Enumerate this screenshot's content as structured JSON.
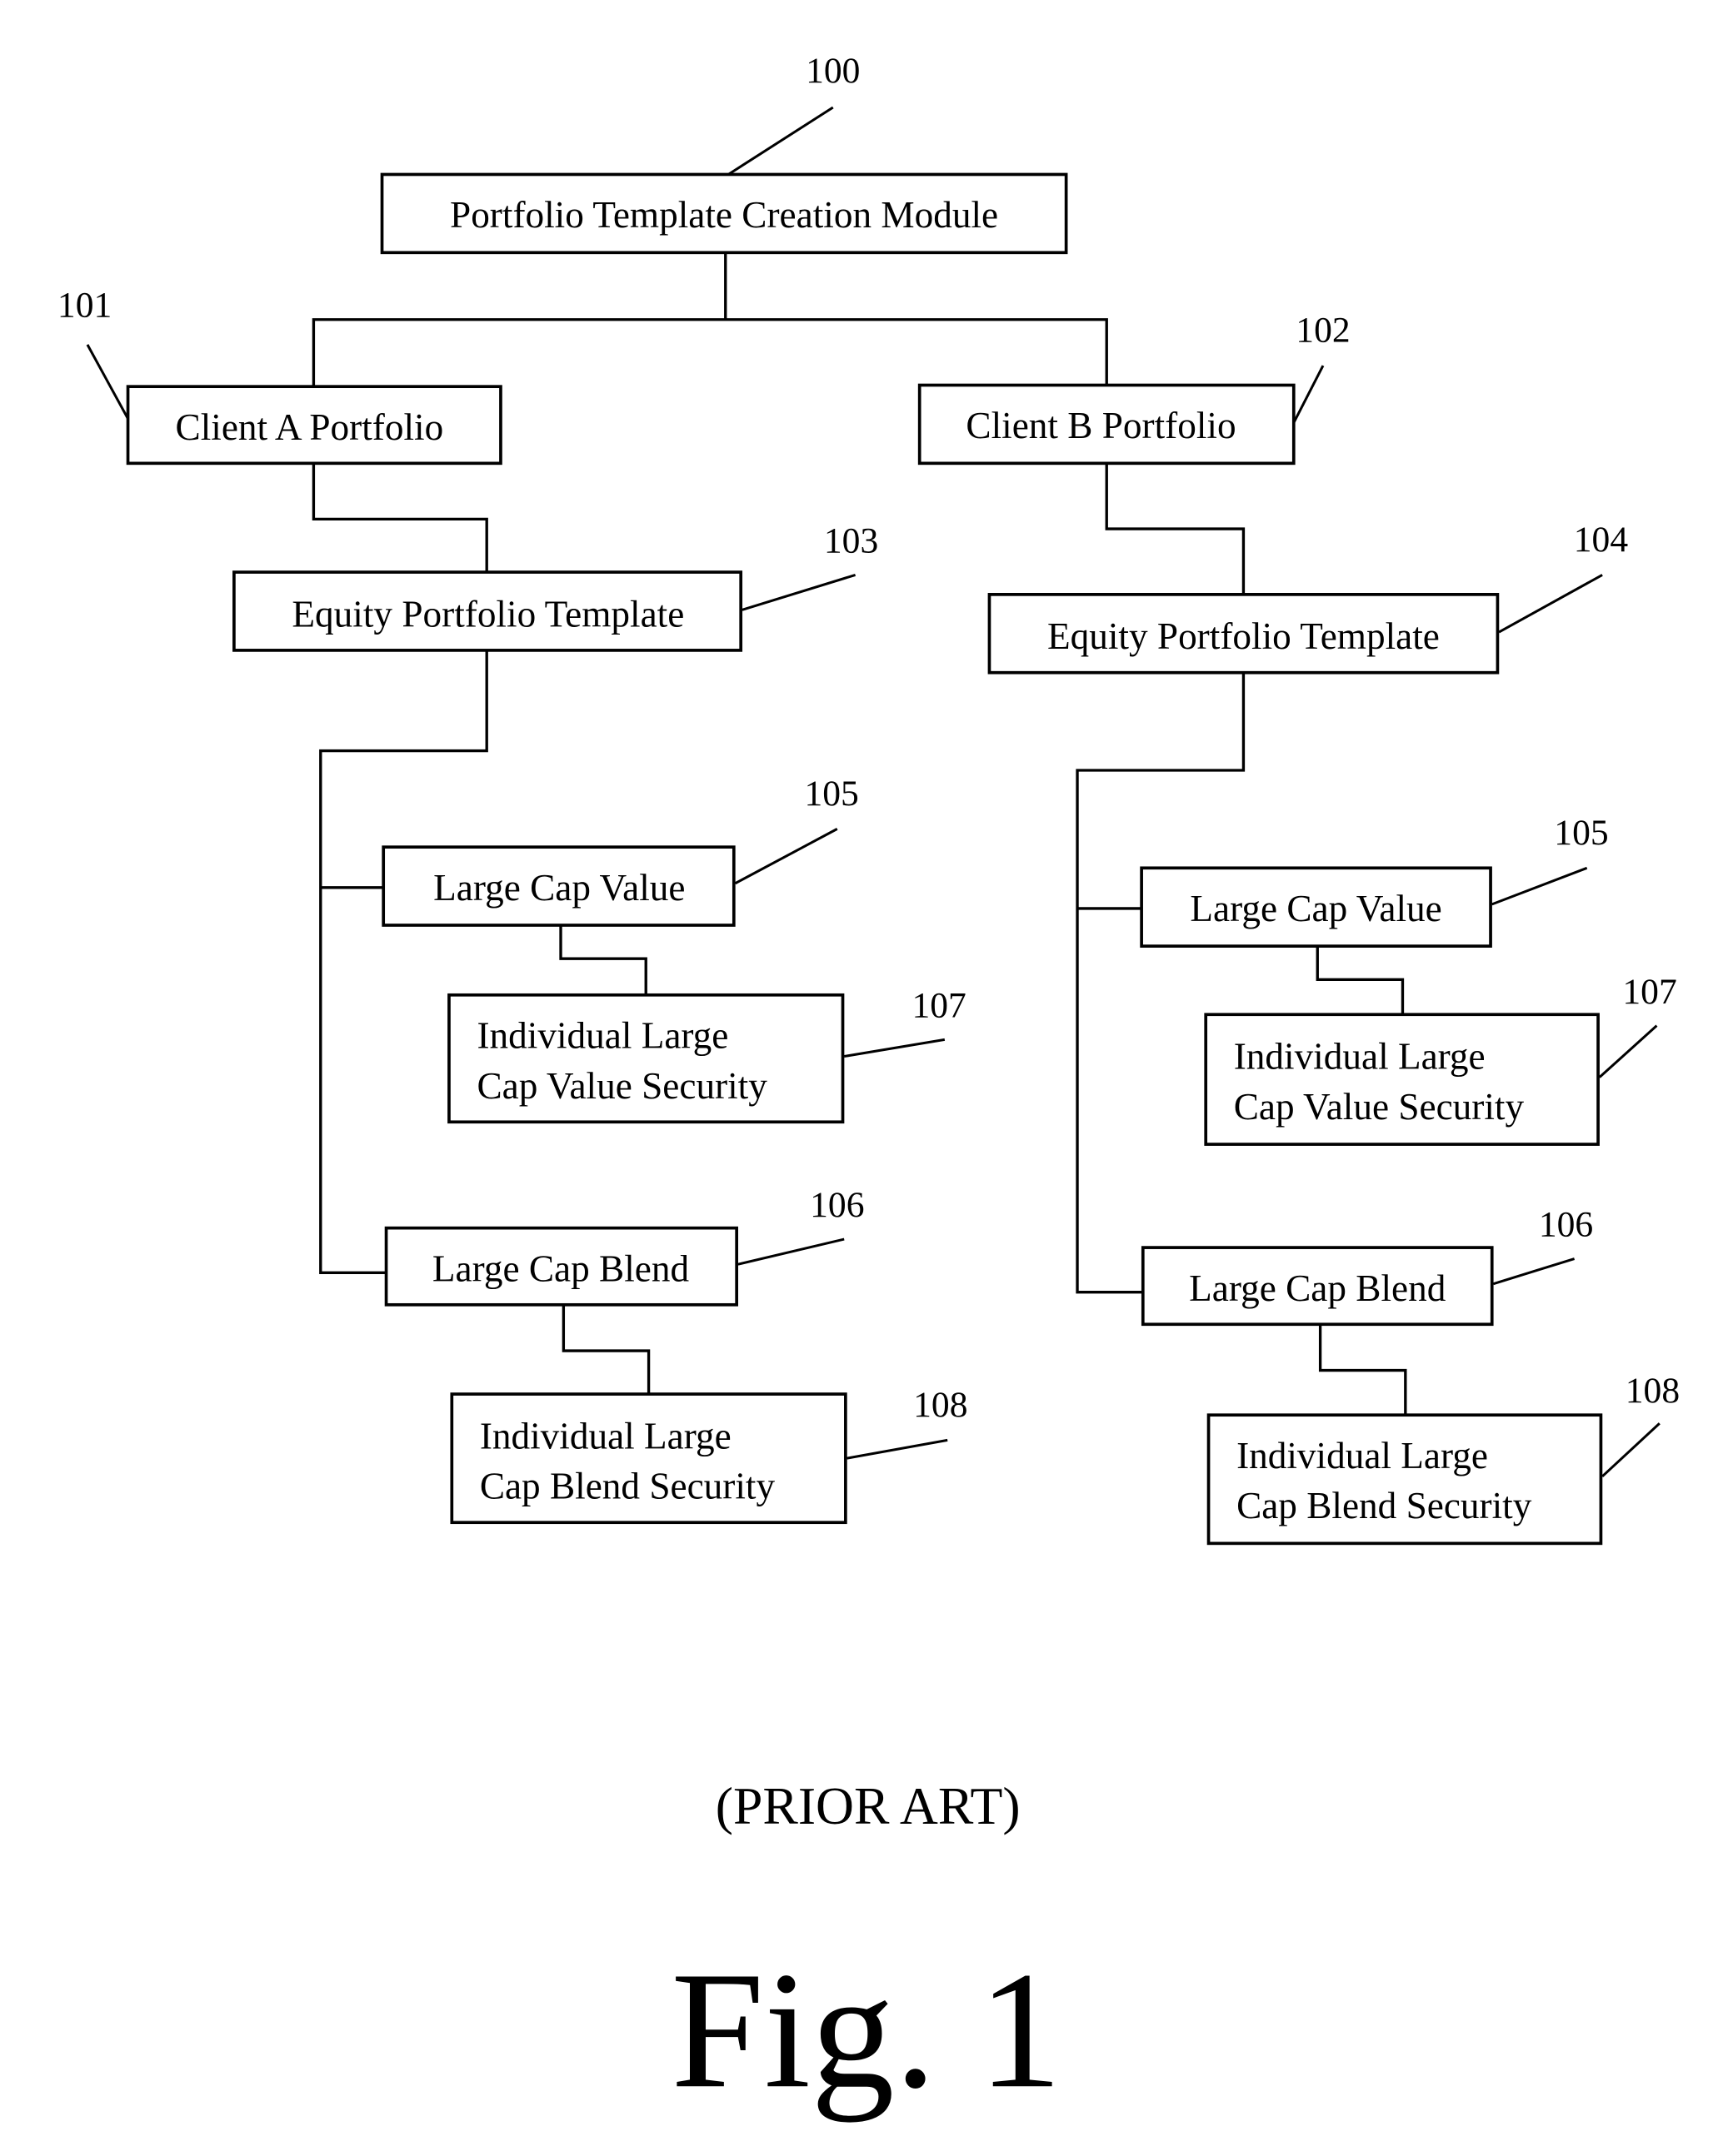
{
  "diagram": {
    "title_module": {
      "label": "Portfolio Template Creation Module",
      "ref": "100"
    },
    "client_a": {
      "portfolio": {
        "label": "Client A Portfolio",
        "ref": "101"
      },
      "template": {
        "label": "Equity Portfolio Template",
        "ref": "103"
      },
      "value": {
        "label": "Large Cap Value",
        "ref": "105"
      },
      "value_security": {
        "line1": "Individual Large",
        "line2": "Cap Value Security",
        "ref": "107"
      },
      "blend": {
        "label": "Large Cap Blend",
        "ref": "106"
      },
      "blend_security": {
        "line1": "Individual Large",
        "line2": "Cap Blend Security",
        "ref": "108"
      }
    },
    "client_b": {
      "portfolio": {
        "label": "Client B Portfolio",
        "ref": "102"
      },
      "template": {
        "label": "Equity Portfolio Template",
        "ref": "104"
      },
      "value": {
        "label": "Large Cap Value",
        "ref": "105"
      },
      "value_security": {
        "line1": "Individual Large",
        "line2": "Cap Value Security",
        "ref": "107"
      },
      "blend": {
        "label": "Large Cap Blend",
        "ref": "106"
      },
      "blend_security": {
        "line1": "Individual Large",
        "line2": "Cap Blend Security",
        "ref": "108"
      }
    },
    "caption": "(PRIOR ART)",
    "figure_label": "Fig. 1"
  }
}
